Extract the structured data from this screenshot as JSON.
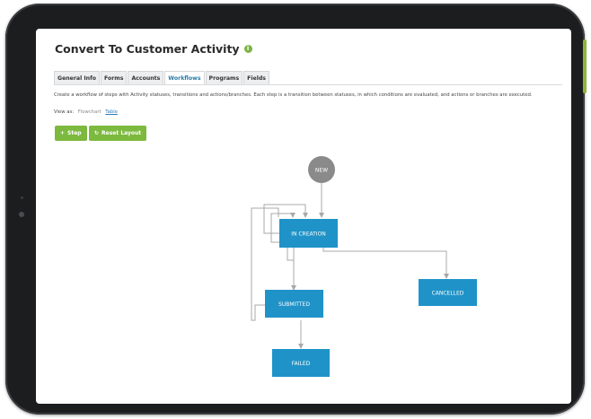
{
  "page": {
    "title": "Convert To Customer Activity",
    "info_icon": "i"
  },
  "tabs": [
    {
      "label": "General Info",
      "active": false
    },
    {
      "label": "Forms",
      "active": false
    },
    {
      "label": "Accounts",
      "active": false
    },
    {
      "label": "Workflows",
      "active": true
    },
    {
      "label": "Programs",
      "active": false
    },
    {
      "label": "Fields",
      "active": false
    }
  ],
  "description": "Create a workflow of steps with Activity statuses, transitions and actions/branches. Each step is a transition between statuses, in which conditions are evaluated, and actions or branches are executed.",
  "view_as": {
    "label": "View as:",
    "current": "Flowchart",
    "link": "Table"
  },
  "buttons": {
    "step": {
      "icon": "+",
      "label": "Step"
    },
    "reset": {
      "icon": "↻",
      "label": "Reset Layout"
    }
  },
  "workflow": {
    "nodes": {
      "new": "NEW",
      "in_creation": "IN CREATION",
      "submitted": "SUBMITTED",
      "cancelled": "CANCELLED",
      "failed": "FAILED"
    }
  },
  "colors": {
    "accent_green": "#7cb93e",
    "node_blue": "#1f93c8",
    "start_node_gray": "#8a8a8a",
    "connector_gray": "#a9a9a9",
    "active_tab_blue": "#2b79a8",
    "device_frame": "#1c1d1f"
  }
}
